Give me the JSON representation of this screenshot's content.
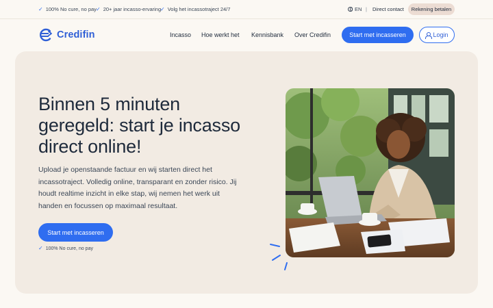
{
  "topbar": {
    "usps": [
      "100% No cure, no pay",
      "20+ jaar incasso-ervaring",
      "Volg het incassotraject 24/7"
    ],
    "language": "EN",
    "separator": "|",
    "direct_contact": "Direct contact",
    "pay_invoice": "Rekening betalen"
  },
  "nav": {
    "logo_text": "Credifin",
    "links": [
      "Incasso",
      "Hoe werkt het",
      "Kennisbank",
      "Over Credifin"
    ],
    "cta": "Start met incasseren",
    "login": "Login"
  },
  "hero": {
    "title": "Binnen 5 minuten geregeld: start je incasso direct online!",
    "text": "Upload je openstaande factuur en wij starten direct het incassotraject. Volledig online, transparant en zonder risico. Jij houdt realtime inzicht in elke stap, wij nemen het werk uit handen en focussen op maximaal resultaat.",
    "cta": "Start met incasseren",
    "guarantee": "100% No cure, no pay"
  },
  "colors": {
    "brand_blue": "#2f6df0",
    "hero_bg": "#f2ebe3",
    "page_bg": "#fbf8f3",
    "pay_button_bg": "#ecdcd3"
  },
  "icons": [
    "check-icon",
    "globe-icon",
    "user-icon",
    "euro-logo-icon",
    "spark-lines-decoration"
  ]
}
